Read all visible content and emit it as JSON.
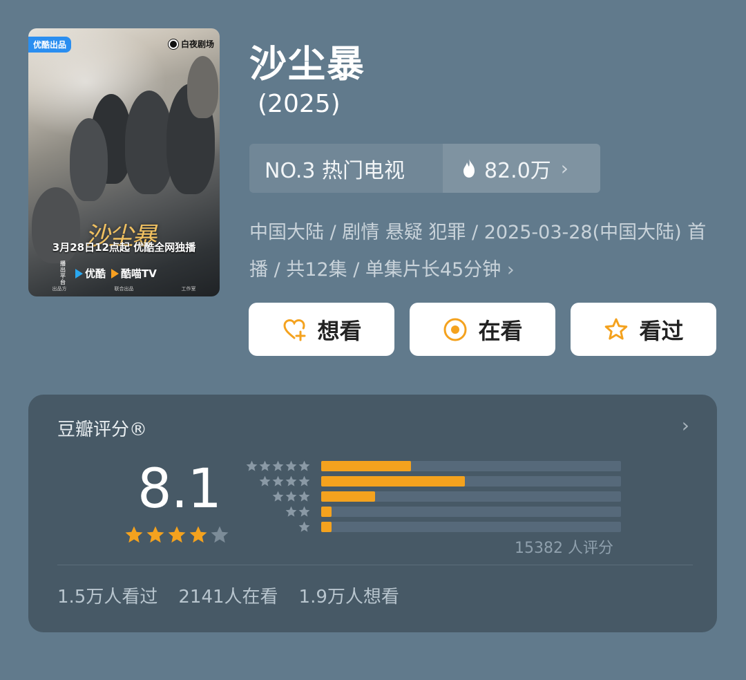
{
  "poster": {
    "badge": "优酷出品",
    "studio": "白夜剧场",
    "title_art": "沙尘暴",
    "release": "3月28日12点起 优酷全网独播",
    "platform_tag": "播出平台",
    "platform_1": "优酷",
    "platform_2": "酷喵TV",
    "footer_1": "出品方",
    "footer_2": "联合出品",
    "footer_3": "工作室"
  },
  "title": "沙尘暴",
  "year": "(2025)",
  "rank": {
    "label": "NO.3 热门电视",
    "heat": "82.0万",
    "chevron": "›"
  },
  "meta": {
    "text": "中国大陆 / 剧情 悬疑 犯罪 / 2025-03-28(中国大陆) 首播 / 共12集 / 单集片长45分钟",
    "arrow": "›"
  },
  "actions": {
    "want": "想看",
    "watching": "在看",
    "watched": "看过"
  },
  "rating": {
    "title": "豆瓣评分®",
    "chevron": "›",
    "score": "8.1",
    "stars_filled": 4,
    "stars_total": 5,
    "distribution": [
      {
        "stars": 5,
        "percent": 30
      },
      {
        "stars": 4,
        "percent": 48
      },
      {
        "stars": 3,
        "percent": 18
      },
      {
        "stars": 2,
        "percent": 3
      },
      {
        "stars": 1,
        "percent": 3
      }
    ],
    "count": "15382 人评分"
  },
  "stats": {
    "watched": "1.5万人看过",
    "watching": "2141人在看",
    "want": "1.9万人想看"
  },
  "colors": {
    "background": "#617a8c",
    "card": "#475966",
    "accent": "#f4a21e",
    "star_filled": "#f4a21e",
    "star_empty": "#7c8c98",
    "heat_icon": "#ffffff"
  }
}
